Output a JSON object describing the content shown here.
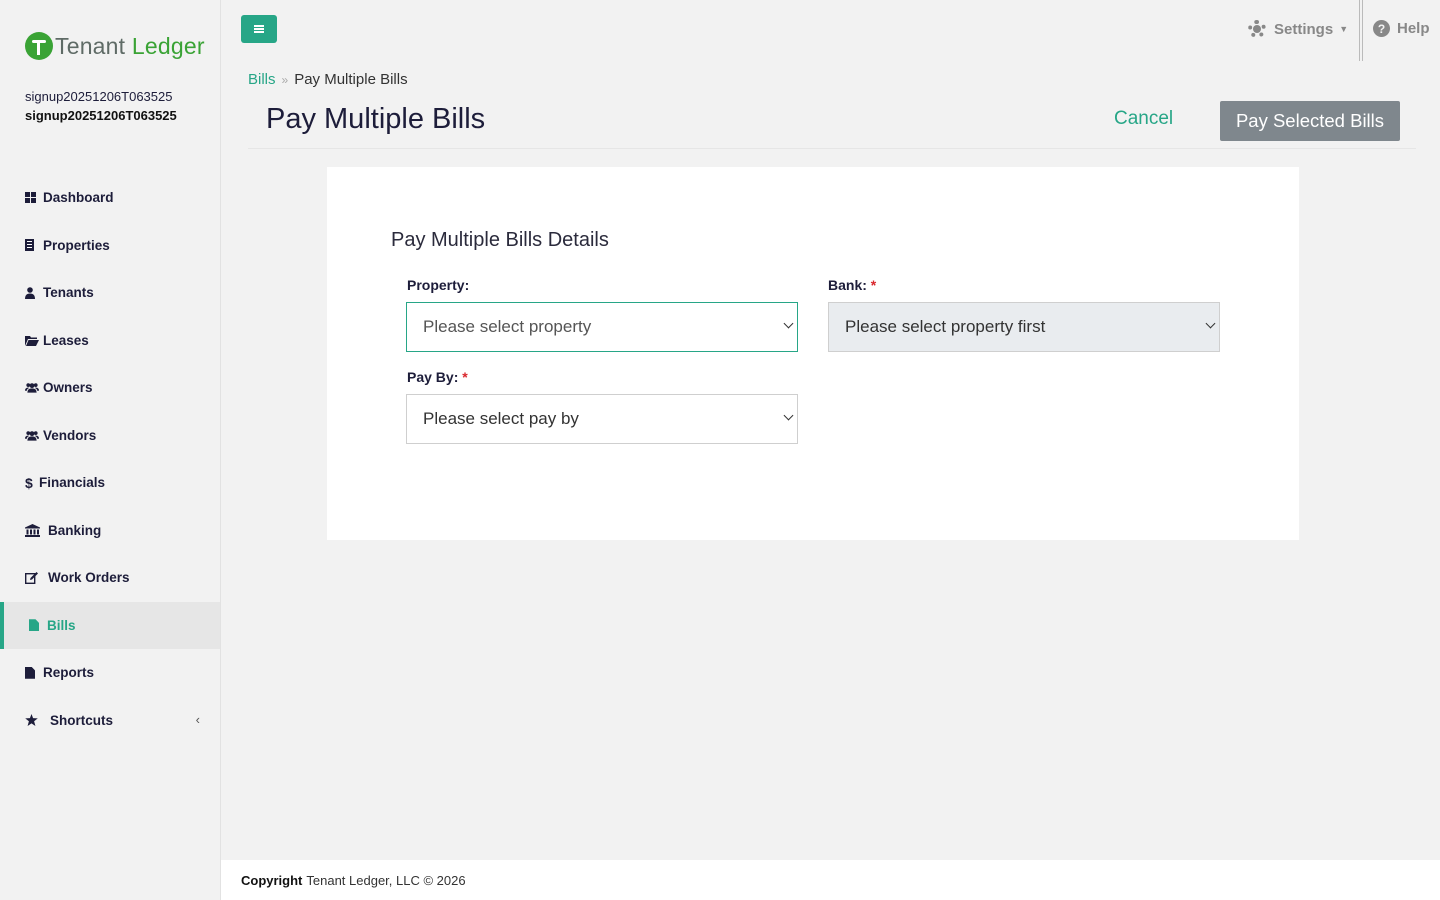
{
  "brand": {
    "name_part1": "Tenant",
    "name_part2": " Ledger"
  },
  "user": {
    "line1": "signup20251206T063525",
    "line2": "signup20251206T063525"
  },
  "sidebar": {
    "items": [
      {
        "label": "Dashboard",
        "icon": "dashboard-icon"
      },
      {
        "label": "Properties",
        "icon": "building-icon"
      },
      {
        "label": "Tenants",
        "icon": "user-icon"
      },
      {
        "label": "Leases",
        "icon": "folder-open-icon"
      },
      {
        "label": "Owners",
        "icon": "users-icon"
      },
      {
        "label": "Vendors",
        "icon": "users-icon"
      },
      {
        "label": "Financials",
        "icon": "dollar-icon"
      },
      {
        "label": "Banking",
        "icon": "bank-icon"
      },
      {
        "label": "Work Orders",
        "icon": "edit-icon"
      },
      {
        "label": "Bills",
        "icon": "file-icon",
        "active": true
      },
      {
        "label": "Reports",
        "icon": "file-icon"
      },
      {
        "label": "Shortcuts",
        "icon": "star-icon"
      }
    ]
  },
  "topbar": {
    "settings_label": "Settings",
    "help_label": "Help"
  },
  "breadcrumb": {
    "parent": "Bills",
    "current": "Pay Multiple Bills"
  },
  "page": {
    "title": "Pay Multiple Bills",
    "cancel_label": "Cancel",
    "pay_label": "Pay Selected Bills"
  },
  "form": {
    "section_title": "Pay Multiple Bills Details",
    "property": {
      "label": "Property:",
      "value": "Please select property"
    },
    "bank": {
      "label": "Bank:",
      "required_mark": "*",
      "value": "Please select property first"
    },
    "pay_by": {
      "label": "Pay By:",
      "required_mark": "*",
      "value": "Please select pay by"
    }
  },
  "footer": {
    "copyright_label": "Copyright",
    "text": "Tenant Ledger, LLC © 2026"
  },
  "colors": {
    "accent": "#27a687",
    "brand_green": "#3aa335",
    "button_gray": "#7f878d",
    "required": "#d9262c"
  }
}
